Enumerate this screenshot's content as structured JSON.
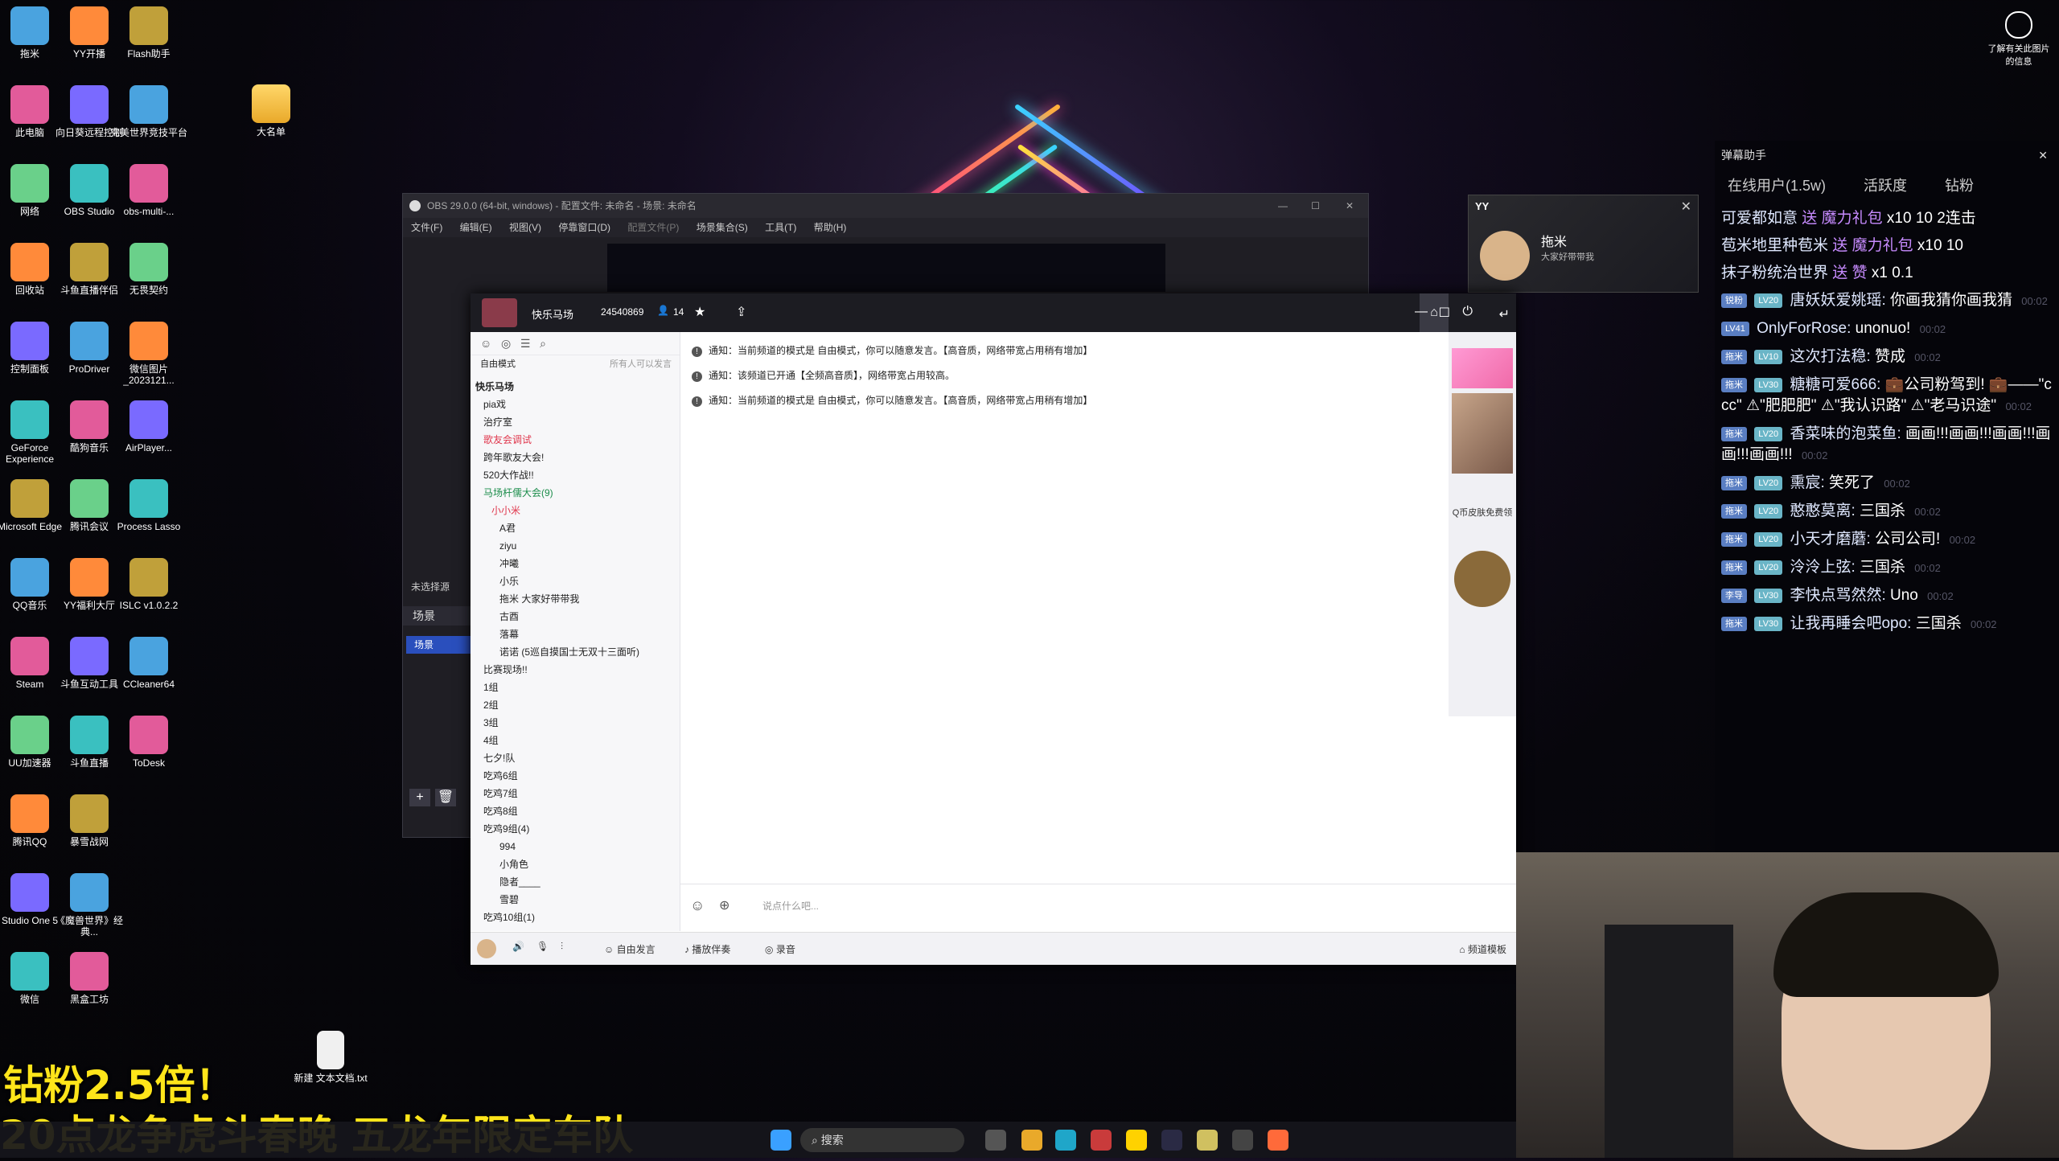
{
  "desktop": {
    "col1": [
      "拖米",
      "此电脑",
      "网络",
      "回收站",
      "控制面板",
      "GeForce Experience",
      "Microsoft Edge",
      "QQ音乐",
      "Steam",
      "UU加速器",
      "腾讯QQ",
      "Studio One 5",
      "微信"
    ],
    "col2": [
      "YY开播",
      "向日葵远程控制",
      "OBS Studio",
      "斗鱼直播伴侣",
      "ProDriver",
      "酷狗音乐",
      "腾讯会议",
      "YY福利大厅",
      "斗鱼互动工具",
      "斗鱼直播",
      "暴雪战网",
      "《魔兽世界》经典...",
      "黑盒工坊"
    ],
    "col3": [
      "Flash助手",
      "完美世界竞技平台",
      "obs-multi-...",
      "无畏契约",
      "微信图片_2023121...",
      "AirPlayer...",
      "Process Lasso",
      "ISLC v1.0.2.2",
      "CCleaner64",
      "ToDesk"
    ],
    "folder_label": "大名单",
    "txt_file_label": "新建 文本文档.txt",
    "info_label": "了解有关此图片的信息"
  },
  "obs": {
    "title": "OBS 29.0.0 (64-bit, windows) - 配置文件: 未命名 - 场景: 未命名",
    "menu": [
      "文件(F)",
      "编辑(E)",
      "视图(V)",
      "停靠窗口(D)",
      "配置文件(P)",
      "场景集合(S)",
      "工具(T)",
      "帮助(H)"
    ],
    "no_source": "未选择源",
    "scenes_header": "场景",
    "scene_item": "场景"
  },
  "yy_small": {
    "logo": "YY",
    "name": "拖米",
    "sign": "大家好带带我"
  },
  "yy": {
    "channel_name": "快乐马场",
    "channel_id": "24540869",
    "online_count": "14",
    "mode": "自由模式",
    "mode_note": "所有人可以发言",
    "tree": [
      {
        "t": "快乐马场",
        "lvl": 0,
        "c": "#222",
        "b": true
      },
      {
        "t": "pia戏",
        "lvl": 1
      },
      {
        "t": "治疗室",
        "lvl": 1
      },
      {
        "t": "歌友会调试",
        "lvl": 1,
        "c": "#e0364c"
      },
      {
        "t": "跨年歌友大会!",
        "lvl": 1
      },
      {
        "t": "520大作战!!",
        "lvl": 1
      },
      {
        "t": "马场杆儒大会(9)",
        "lvl": 1,
        "c": "#1a8c4a"
      },
      {
        "t": "小小米",
        "lvl": 2,
        "c": "#e0364c"
      },
      {
        "t": "A君",
        "lvl": 3
      },
      {
        "t": "ziyu",
        "lvl": 3
      },
      {
        "t": "冲曦",
        "lvl": 3
      },
      {
        "t": "小乐",
        "lvl": 3
      },
      {
        "t": "拖米  大家好带带我",
        "lvl": 3
      },
      {
        "t": "古酉",
        "lvl": 3
      },
      {
        "t": "落幕",
        "lvl": 3
      },
      {
        "t": "诺诺 (5巡自摸国士无双十三面听)",
        "lvl": 3
      },
      {
        "t": "比赛现场!!",
        "lvl": 1
      },
      {
        "t": "1组",
        "lvl": 1
      },
      {
        "t": "2组",
        "lvl": 1
      },
      {
        "t": "3组",
        "lvl": 1
      },
      {
        "t": "4组",
        "lvl": 1
      },
      {
        "t": "七夕!队",
        "lvl": 1
      },
      {
        "t": "吃鸡6组",
        "lvl": 1
      },
      {
        "t": "吃鸡7组",
        "lvl": 1
      },
      {
        "t": "吃鸡8组",
        "lvl": 1
      },
      {
        "t": "吃鸡9组(4)",
        "lvl": 1
      },
      {
        "t": "994",
        "lvl": 3
      },
      {
        "t": "小角色",
        "lvl": 3
      },
      {
        "t": "隐者____",
        "lvl": 3
      },
      {
        "t": "雪碧",
        "lvl": 3
      },
      {
        "t": "吃鸡10组(1)",
        "lvl": 1
      }
    ],
    "notices": [
      "通知：当前频道的模式是 自由模式，你可以随意发言。【高音质，网络带宽占用稍有增加】",
      "通知：该频道已开通【全频高音质】，网络带宽占用较高。",
      "通知：当前频道的模式是 自由模式，你可以随意发言。【高音质，网络带宽占用稍有增加】"
    ],
    "input_placeholder": "说点什么吧...",
    "bottom": {
      "free_speak": "自由发言",
      "accompany": "播放伴奏",
      "record": "录音",
      "template": "频道模板"
    },
    "right_strip_label": "Q币皮肤免费领"
  },
  "danmu": {
    "title": "弹幕助手",
    "tabs": [
      "在线用户(1.5w)",
      "活跃度",
      "钻粉"
    ],
    "messages": [
      {
        "user": "可爱都如意",
        "act": "送",
        "gift": "魔力礼包",
        "count": "x10",
        "val": "10",
        "extra": "2连击"
      },
      {
        "user": "苞米地里种苞米",
        "act": "送",
        "gift": "魔力礼包",
        "count": "x10",
        "val": "10"
      },
      {
        "user": "抹子粉统治世界",
        "act": "送",
        "gift": "赞",
        "count": "x1",
        "val": "0.1"
      },
      {
        "b1": "锐粉",
        "b2": "LV20",
        "user": "唐妖妖爱姚瑶:",
        "text": "你画我猜你画我猜",
        "time": "00:02"
      },
      {
        "b1": "LV41",
        "user": "OnlyForRose:",
        "text": "unonuo!",
        "time": "00:02"
      },
      {
        "b1": "拖米",
        "b2": "LV10",
        "user": "这次打法稳:",
        "text": "赞成",
        "time": "00:02"
      },
      {
        "b1": "拖米",
        "b2": "LV30",
        "user": "糖糖可爱666:",
        "text": "💼公司粉驾到! 💼——\"ccc\" ⚠\"肥肥肥\" ⚠\"我认识路\" ⚠\"老马识途\"",
        "time": "00:02"
      },
      {
        "b1": "拖米",
        "b2": "LV20",
        "user": "香菜味的泡菜鱼:",
        "text": "画画!!!画画!!!画画!!!画画!!!画画!!!",
        "time": "00:02"
      },
      {
        "b1": "拖米",
        "b2": "LV20",
        "user": "熏宸:",
        "text": "笑死了",
        "time": "00:02"
      },
      {
        "b1": "拖米",
        "b2": "LV20",
        "user": "憨憨莫离:",
        "text": "三国杀",
        "time": "00:02"
      },
      {
        "b1": "拖米",
        "b2": "LV20",
        "user": "小天才磨蘑:",
        "text": "公司公司!",
        "time": "00:02"
      },
      {
        "b1": "拖米",
        "b2": "LV20",
        "user": "泠泠上弦:",
        "text": "三国杀",
        "time": "00:02"
      },
      {
        "b1": "李导",
        "b2": "LV30",
        "user": "李快点骂然然:",
        "text": "Uno",
        "time": "00:02"
      },
      {
        "b1": "拖米",
        "b2": "LV30",
        "user": "让我再睡会吧opo:",
        "text": "三国杀",
        "time": "00:02"
      }
    ]
  },
  "caption": {
    "line1": "钻粉2.5倍！",
    "line2": "20点龙争虎斗春晚 五龙年限定车队"
  },
  "taskbar": {
    "search": "搜索"
  }
}
